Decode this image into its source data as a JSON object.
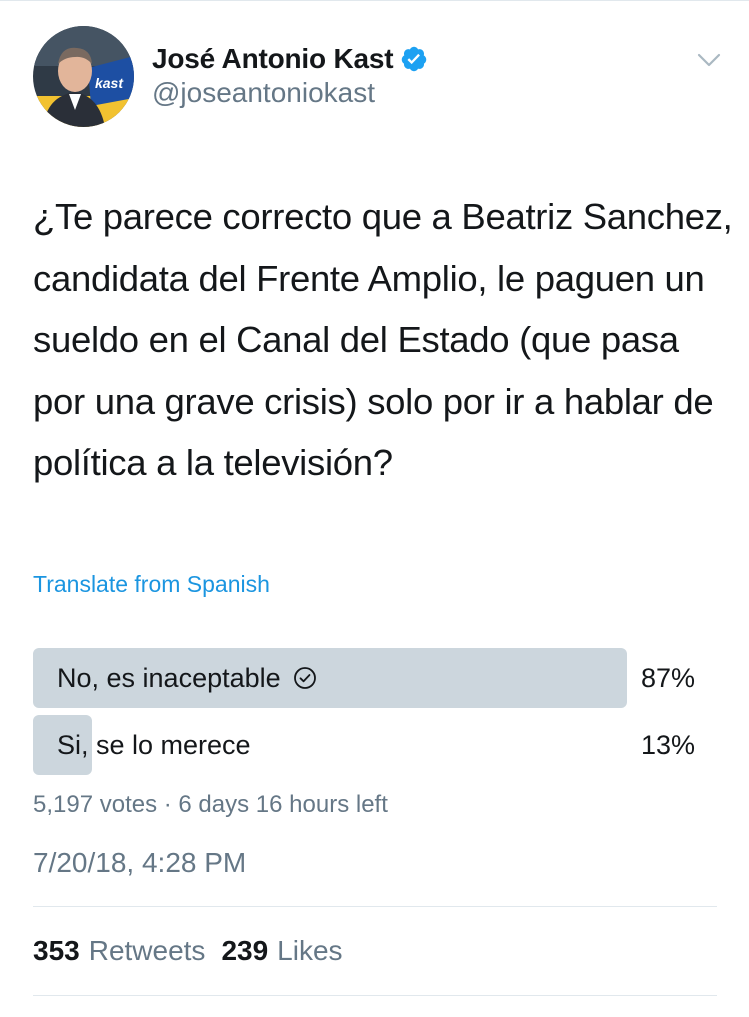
{
  "author": {
    "display_name": "José Antonio Kast",
    "handle": "@joseantoniokast",
    "avatar_badge_text": "kast"
  },
  "tweet": {
    "text": "¿Te parece correcto que a Beatriz Sanchez, candidata del Frente Amplio, le paguen un sueldo en el Canal del Estado (que pasa por una grave crisis) solo por ir a hablar de política a la televisión?",
    "translate_label": "Translate from Spanish",
    "timestamp": "7/20/18, 4:28 PM"
  },
  "poll": {
    "options": [
      {
        "label": "No, es inaceptable",
        "percent_text": "87%",
        "percent": 87,
        "winner": true
      },
      {
        "label": "Si, se lo merece",
        "percent_text": "13%",
        "percent": 13,
        "winner": false
      }
    ],
    "meta": "5,197 votes · 6 days 16 hours left"
  },
  "stats": {
    "retweets_count": "353",
    "retweets_label": "Retweets",
    "likes_count": "239",
    "likes_label": "Likes"
  },
  "colors": {
    "verified": "#1da1f2",
    "link": "#1b95e0",
    "poll_bar": "#ccd6dd",
    "secondary_text": "#657786"
  }
}
